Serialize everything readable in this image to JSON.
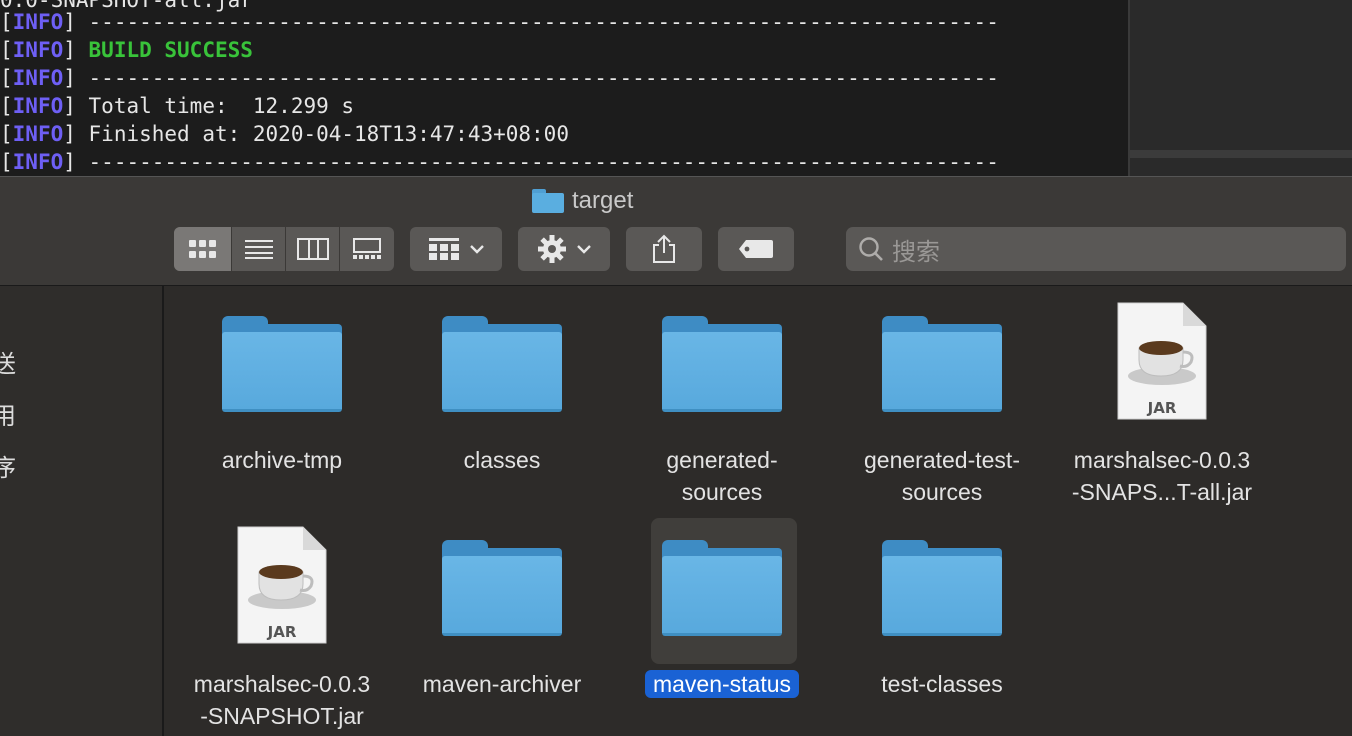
{
  "terminal": {
    "lines": [
      {
        "tag": "",
        "text": "0.0-SNAPSHOT-all.jar"
      },
      {
        "tag": "INFO",
        "text": "------------------------------------------------------------------------"
      },
      {
        "tag": "INFO",
        "text": "BUILD SUCCESS"
      },
      {
        "tag": "INFO",
        "text": "------------------------------------------------------------------------"
      },
      {
        "tag": "INFO",
        "text": "Total time:  12.299 s"
      },
      {
        "tag": "INFO",
        "text": "Finished at: 2020-04-18T13:47:43+08:00"
      },
      {
        "tag": "INFO",
        "text": "------------------------------------------------------------------------"
      }
    ],
    "colors": {
      "tag": "#6e5ff5",
      "success": "#39c33a"
    }
  },
  "finder": {
    "title": "target",
    "toolbar": {
      "view_icons": [
        "icon-view-icon",
        "list-view-icon",
        "column-view-icon",
        "gallery-view-icon"
      ],
      "group_icon": "group-by-icon",
      "action_icon": "gear-icon",
      "share_icon": "share-icon",
      "tag_icon": "tag-icon",
      "search_placeholder": "搜索"
    },
    "sidebar": {
      "items": [
        "送",
        "用",
        "序"
      ]
    },
    "items": [
      {
        "name_line1": "archive-tmp",
        "name_line2": "",
        "kind": "folder"
      },
      {
        "name_line1": "classes",
        "name_line2": "",
        "kind": "folder"
      },
      {
        "name_line1": "generated-",
        "name_line2": "sources",
        "kind": "folder"
      },
      {
        "name_line1": "generated-test-",
        "name_line2": "sources",
        "kind": "folder"
      },
      {
        "name_line1": "marshalsec-0.0.3",
        "name_line2": "-SNAPS...T-all.jar",
        "kind": "jar"
      },
      {
        "name_line1": "marshalsec-0.0.3",
        "name_line2": "-SNAPSHOT.jar",
        "kind": "jar"
      },
      {
        "name_line1": "maven-archiver",
        "name_line2": "",
        "kind": "folder"
      },
      {
        "name_line1": "maven-status",
        "name_line2": "",
        "kind": "folder",
        "selected": true
      },
      {
        "name_line1": "test-classes",
        "name_line2": "",
        "kind": "folder"
      }
    ],
    "jar_badge": "JAR",
    "selection_color": "#1a62d4",
    "folder_color": "#5aaee0"
  }
}
